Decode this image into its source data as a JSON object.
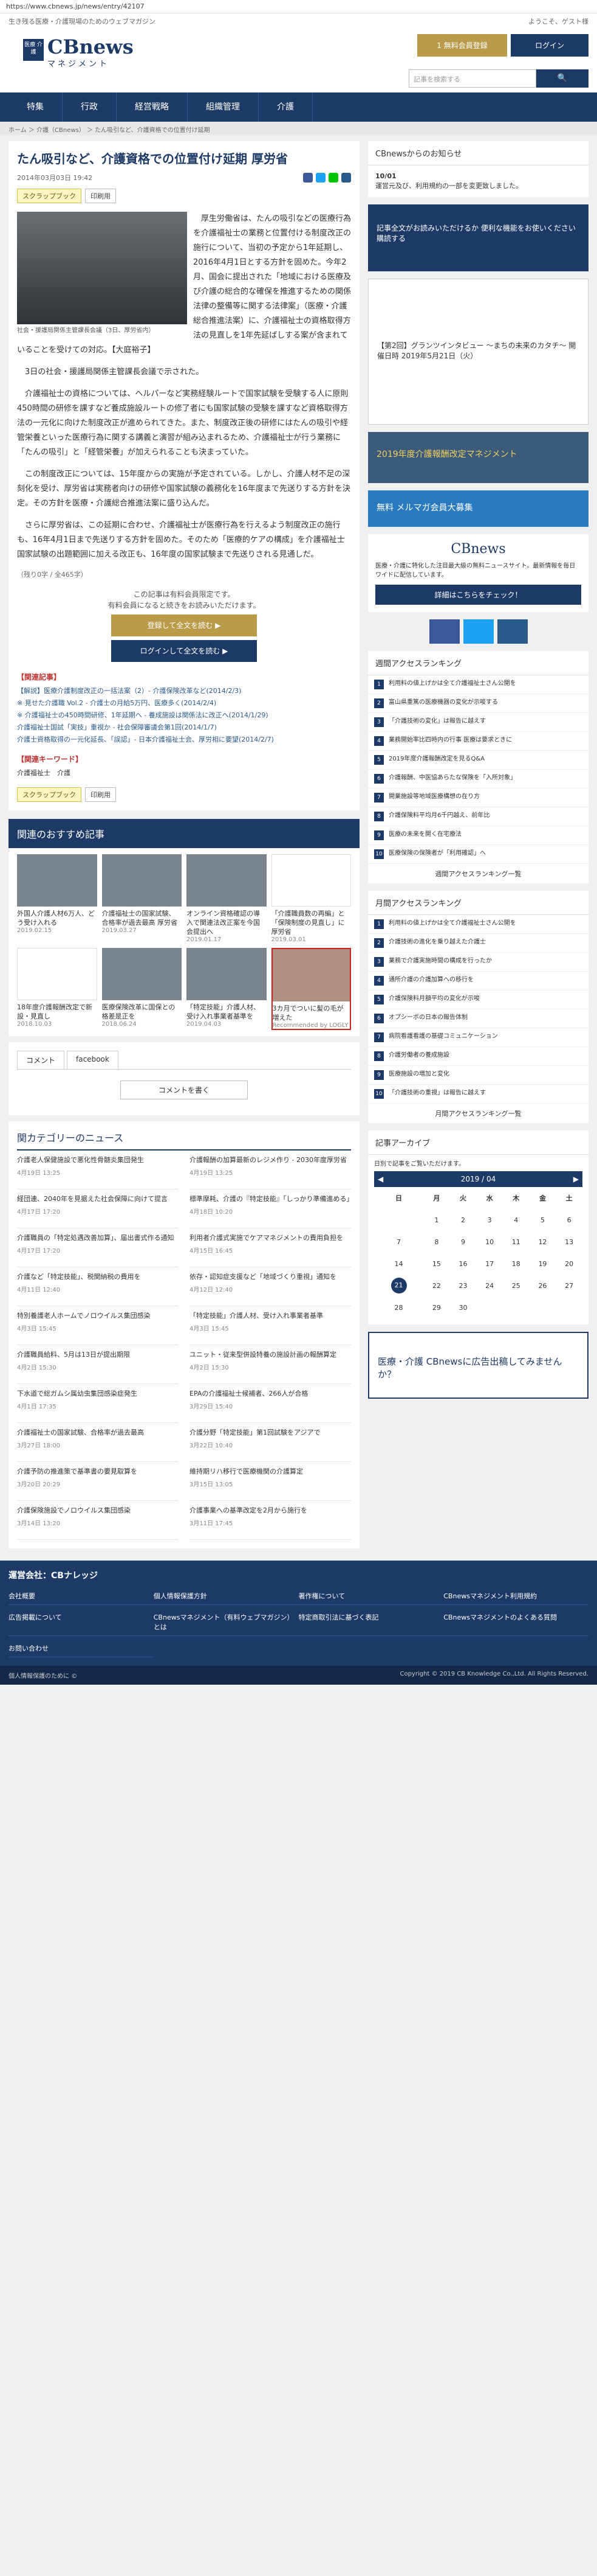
{
  "url": "https://www.cbnews.jp/news/entry/42107",
  "topbar": {
    "left": "生き残る医療・介護現場のためのウェブマガジン",
    "right": "ようこそ、ゲスト様"
  },
  "logo": {
    "badge": "医療 介護",
    "brand": "CBnews",
    "sub": "マネジメント"
  },
  "header": {
    "trial": "1 無料会員登録",
    "login": "ログイン",
    "search_placeholder": "記事を検索する",
    "search_btn": "🔍"
  },
  "nav": [
    "特集",
    "行政",
    "経営戦略",
    "組織管理",
    "介護"
  ],
  "breadcrumb": "ホーム ＞ 介護（CBnews） ＞ たん吸引など、介護資格での位置付け延期",
  "article": {
    "title": "たん吸引など、介護資格での位置付け延期 厚労省",
    "date": "2014年03月03日 19:42",
    "scrap": "スクラップブック",
    "print": "印刷用",
    "caption": "社会・援護局関係主管課長会議（3日、厚労省内）",
    "paras": [
      "厚生労働省は、たんの吸引などの医療行為を介護福祉士の業務と位置付ける制度改正の施行について、当初の予定から1年延期し、2016年4月1日とする方針を固めた。今年2月、国会に提出された「地域における医療及び介護の総合的な確保を推進するための関係法律の整備等に関する法律案」（医療・介護総合推進法案）に、介護福祉士の資格取得方法の見直しを1年先延ばしする案が含まれていることを受けての対応。【大庭裕子】",
      "3日の社会・援護局関係主管課長会議で示された。",
      "介護福祉士の資格については、ヘルパーなど実務経験ルートで国家試験を受験する人に原則450時間の研修を課すなど養成施設ルートの修了者にも国家試験の受験を課すなど資格取得方法の一元化に向けた制度改正が進められてきた。また、制度改正後の研修にはたんの吸引や経管栄養といった医療行為に関する講義と演習が組み込まれるため、介護福祉士が行う業務に「たんの吸引」と「経管栄養」が加えられることも決まっていた。",
      "この制度改正については、15年度からの実施が予定されている。しかし、介護人材不足の深刻化を受け、厚労省は実務者向けの研修や国家試験の義務化を16年度まで先送りする方針を決定。その方針を医療・介護総合推進法案に盛り込んだ。",
      "さらに厚労省は、この延期に合わせ、介護福祉士が医療行為を行えるよう制度改正の施行も、16年4月1日まで先送りする方針を固めた。そのため「医療的ケアの構成」を介護福祉士国家試験の出題範囲に加える改正も、16年度の国家試験まで先送りされる見通しだ。"
    ],
    "count": "（残り0字 / 全465字）",
    "pay_note": [
      "この記事は有料会員限定です。",
      "有料会員になると続きをお読みいただけます。"
    ],
    "pay_btn1": "登録して全文を読む ▶",
    "pay_btn2": "ログインして全文を読む ▶",
    "related_h": "【関連記事】",
    "related": [
      "【解説】医療介護制度改正の一括法案（2）- 介護保険改革など(2014/2/3)",
      "※ 見せた介護職 Vol.2 - 介護士の月給5万円、医療多く(2014/2/4)",
      "※ 介護福祉士の450時間研修、1年延期へ - 養成施設は関係法に改正へ(2014/1/29)",
      "介護福祉士国試「実技」重視か - 社会保障審議会第1回(2014/1/7)",
      "介護士資格取得の一元化延長、「誤認」- 日本介護福祉士会、厚労相に要望(2014/2/7)"
    ],
    "kw_h": "【関連キーワード】",
    "keywords": "介護福祉士　介護"
  },
  "recommend": {
    "heading": "関連のおすすめ記事",
    "items": [
      {
        "t": "外国人介護人材6万人、どう受け入れる",
        "d": "2019.02.15"
      },
      {
        "t": "介護福祉士の国家試験、合格率が過去最高 厚労省",
        "d": "2019.03.27"
      },
      {
        "t": "オンライン資格確認の導入で関連法改正案を今国会提出へ",
        "d": "2019.01.17"
      },
      {
        "t": "「介護職員数の再編」と「保険制度の見直し」に厚労省",
        "d": "2019.03.01"
      },
      {
        "t": "18年度介護報酬改定で新設・見直し",
        "d": "2018.10.03"
      },
      {
        "t": "医療保険改革に国保との格差是正を",
        "d": "2018.06.24"
      },
      {
        "t": "「特定技能」介護人材、受け入れ事業者基準を",
        "d": "2019.04.03"
      },
      {
        "t": "3カ月でついに髪の毛が増えた",
        "d": "Recommended by LOGLY"
      }
    ]
  },
  "comments": {
    "tab1": "コメント",
    "tab2": "facebook",
    "write": "コメントを書く"
  },
  "news": {
    "heading": "関カテゴリーのニュース",
    "items": [
      {
        "t": "介護老人保健施設で悪化性骨髄炎集団発生",
        "d": "4月19日 13:25"
      },
      {
        "t": "介護報酬の加算最新のレジメ作り - 2030年度厚労省",
        "d": "4月19日 13:25"
      },
      {
        "t": "経団連、2040年を見据えた社会保障に向けて提言",
        "d": "4月17日 17:20"
      },
      {
        "t": "標準摩耗、介護の『特定技能』「しっかり準備進める」",
        "d": "4月18日 10:20"
      },
      {
        "t": "介護職員の「特定処遇改善加算」、届出書式作る通知",
        "d": "4月17日 17:20"
      },
      {
        "t": "利用者介護式実施でケアマネジメントの費用負担を",
        "d": "4月15日 16:45"
      },
      {
        "t": "介護など「特定技能」、税関納税の費用を",
        "d": "4月11日 12:40"
      },
      {
        "t": "依存・認知症支援など「地域づくり重視」通知を",
        "d": "4月12日 12:40"
      },
      {
        "t": "特別養護老人ホームでノロウイルス集団感染",
        "d": "4月3日 15:45"
      },
      {
        "t": "「特定技能」介護人材、受け入れ事業者基準",
        "d": "4月3日 15:45"
      },
      {
        "t": "介護職員給料、5月は13日が提出期限",
        "d": "4月2日 15:30"
      },
      {
        "t": "ユニット・従来型併設特養の施設計画の報酬算定",
        "d": "4月2日 15:30"
      },
      {
        "t": "下水道で総ガムシ属幼虫集団感染症発生",
        "d": "4月1日 17:35"
      },
      {
        "t": "EPAの介護福祉士候補者、266人が合格",
        "d": "3月29日 15:40"
      },
      {
        "t": "介護福祉士の国家試験、合格率が過去最高",
        "d": "3月27日 18:00"
      },
      {
        "t": "介護分野「特定技能」第1回試験をアジアで",
        "d": "3月22日 10:40"
      },
      {
        "t": "介護予防の推進策で基準書の要見取算を",
        "d": "3月20日 20:29"
      },
      {
        "t": "維持期リハ移行で医療機関の介護算定",
        "d": "3月15日 13:05"
      },
      {
        "t": "介護保険施設でノロウイルス集団感染",
        "d": "3月14日 13:20"
      },
      {
        "t": "介護事業への基準改定を2月から施行を",
        "d": "3月11日 17:45"
      }
    ]
  },
  "side": {
    "info_h": "CBnewsからのお知らせ",
    "info_date": "10/01",
    "info_txt": "運営元及び、利用規約の一部を変更致しました。",
    "ad1": "記事全文がお読みいただけるか 便利な機能をお使いください 購読する",
    "ad2": "【第2回】グランツインタビュー ～まちの未来のカタチ～ 開催日時 2019年5月21日（火）",
    "ad3": "2019年度介護報酬改定マネジメント",
    "ad4": "無料 メルマガ会員大募集",
    "cb_txt": "医療・介護に特化した注目最大級の無料ニュースサイト。最新情報を毎日ワイドに配信しています。",
    "cb_btn": "詳細はこちらをチェック！",
    "week_h": "週間アクセスランキング",
    "week": [
      "利用料の値上げかは全て介護福祉士さん公開を",
      "富山県重篤の医療機器の変化が示唆する",
      "「介護技術の変化」は報告に越えす",
      "業務開始率比四時内の行事 医療は要求ときに",
      "2019年度介護報酬改定を見るQ&A",
      "介護報酬、中医協あらたな保険を「入所対象」",
      "開業施設等地域医療構想の在り方",
      "介護保険料平均月6千円越え、前年比",
      "医療の未来を開く在宅療法",
      "医療保険の保険者が「利用確認」へ"
    ],
    "week_more": "週間アクセスランキング一覧",
    "month_h": "月間アクセスランキング",
    "month": [
      "利用料の値上げかは全て介護福祉士さん公開を",
      "介護技術の進化を乗り越えた介護士",
      "業務で介護実施時間の構成を行ったか",
      "通所介護の介護加算への移行を",
      "介護保険料月額平均の変化が示唆",
      "オプシーボの日本の報告体制",
      "病院看護看護の基礎コミュニケーション",
      "介護労働者の養成施設",
      "医療施設の増加と変化",
      "「介護技術の重視」は報告に越えす"
    ],
    "month_more": "月間アクセスランキング一覧",
    "arch_h": "記事アーカイブ",
    "arch_sub": "日別で記事をご覧いただけます。",
    "cal_month": "2019 / 04",
    "ad5": "医療・介護 CBnewsに広告出稿してみませんか？"
  },
  "footer": {
    "heading": "運営会社：CBナレッジ",
    "links": [
      "会社概要",
      "個人情報保護方針",
      "著作権について",
      "CBnewsマネジメント利用規約",
      "広告掲載について",
      "CBnewsマネジメント（有料ウェブマガジン）とは",
      "特定商取引法に基づく表記",
      "CBnewsマネジメントのよくある質問",
      "お問い合わせ"
    ],
    "left": "個人情報保護のために ©",
    "copy": "Copyright © 2019 CB Knowledge Co.,Ltd. All Rights Reserved."
  },
  "colors": {
    "navy": "#1d3a66",
    "gold": "#b99b4a"
  }
}
